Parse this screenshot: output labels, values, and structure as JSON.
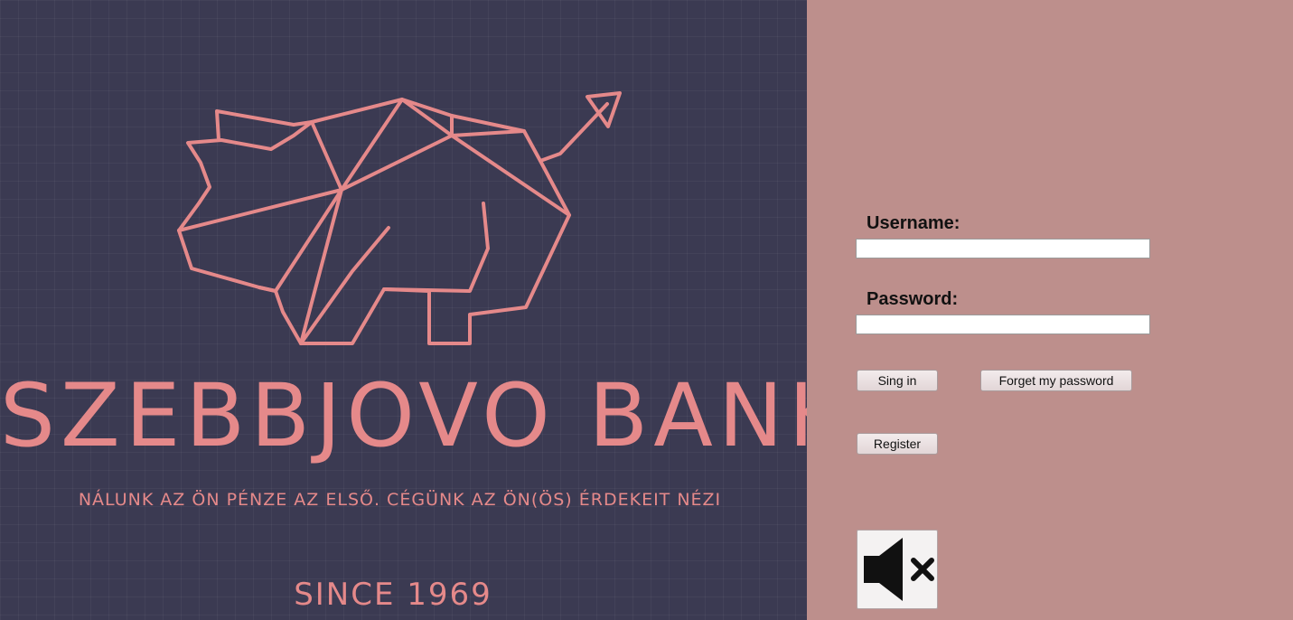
{
  "brand": {
    "name": "SZEBBJOVO BANK",
    "tagline": "NÁLUNK AZ ÖN PÉNZE AZ ELSŐ.  CÉGÜNK AZ ÖN(ÖS) ÉRDEKEIT NÉZI",
    "since": "SINCE 1969",
    "accent_color": "#e5898a",
    "background_color": "#3b3a52"
  },
  "login": {
    "background_color": "#bd8f8c",
    "username_label": "Username:",
    "username_value": "",
    "password_label": "Password:",
    "password_value": "",
    "sign_in_label": "Sing in",
    "forgot_label": "Forget my password",
    "register_label": "Register",
    "mute_icon": "speaker-muted-icon"
  }
}
